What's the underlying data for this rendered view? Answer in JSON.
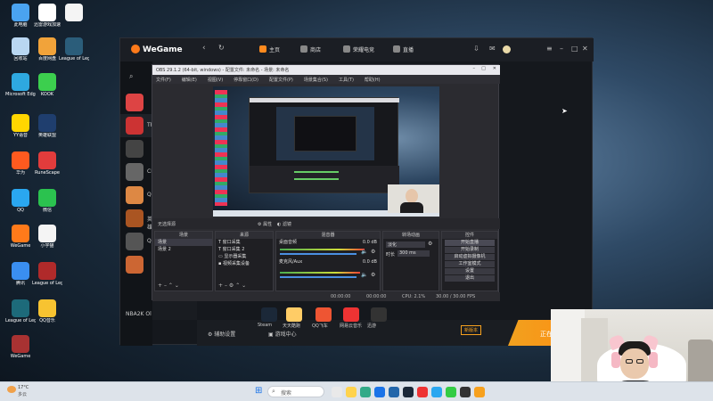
{
  "desktop": {
    "icons": [
      {
        "label": "此电脑",
        "color": "#4aa3f0"
      },
      {
        "label": "迅雷游戏加速",
        "color": "#ffffff"
      },
      {
        "label": "",
        "color": "#f4f4f4"
      },
      {
        "label": "回收站",
        "color": "#b9d7f2"
      },
      {
        "label": "百度网盘",
        "color": "#f1a33a"
      },
      {
        "label": "League of Legends",
        "color": "#2b5d7a"
      },
      {
        "label": "Microsoft Edge",
        "color": "#2ea8e0"
      },
      {
        "label": "KOOK",
        "color": "#3ccf4e"
      },
      {
        "label": "YY语音",
        "color": "#ffd600"
      },
      {
        "label": "英雄联盟",
        "color": "#1f3e6e"
      },
      {
        "label": "华为",
        "color": "#ff5a1f"
      },
      {
        "label": "RuneScape",
        "color": "#e23c3c"
      },
      {
        "label": "QQ",
        "color": "#2aa7f0"
      },
      {
        "label": "微信",
        "color": "#2bc24f"
      },
      {
        "label": "WeGame",
        "color": "#ff7a1a"
      },
      {
        "label": "小学猫",
        "color": "#f4f4f4"
      },
      {
        "label": "腾讯",
        "color": "#3a8ef0"
      },
      {
        "label": "League of Legends",
        "color": "#b02a2a"
      },
      {
        "label": "League of Legends",
        "color": "#1d6a7a"
      },
      {
        "label": "QQ音乐",
        "color": "#f7c331"
      },
      {
        "label": "WeGame",
        "color": "#a83232"
      }
    ],
    "mouse_icon": "cursor-arrow"
  },
  "wegame": {
    "logo": "WeGame",
    "nav": [
      "主页",
      "商店",
      "荣耀电竞",
      "直播"
    ],
    "games": [
      "",
      "TFT",
      "",
      "CF",
      "QQ",
      "英雄",
      "QQ",
      ""
    ],
    "nba_label": "NBA2K Ol",
    "bottom": {
      "left_btn": "辅助设置",
      "right_btn": "游戏中心",
      "mini_btn": "新版本",
      "launch": "正在运行"
    },
    "bottom_tiles": [
      "Steam",
      "天天酷跑",
      "QQ飞车",
      "网易云音乐",
      "迅游"
    ]
  },
  "obs": {
    "title": "OBS 29.1.2 (64-bit, windows) - 配置文件: 未命名 - 场景: 未命名",
    "menu": [
      "文件(F)",
      "编辑(E)",
      "视图(V)",
      "停靠窗口(D)",
      "配置文件(P)",
      "场景集合(S)",
      "工具(T)",
      "帮助(H)"
    ],
    "toolbar_label": "无选择源",
    "toolbar_btn1": "属性",
    "toolbar_btn2": "滤镜",
    "docks": {
      "scenes": {
        "title": "场景",
        "items": [
          "场景",
          "场景 2"
        ]
      },
      "sources": {
        "title": "来源",
        "items": [
          "窗口采集",
          "窗口采集 2",
          "显示器采集",
          "视频采集设备"
        ]
      },
      "mixer": {
        "title": "混音器",
        "items": [
          {
            "name": "桌面音频",
            "db": "0.0 dB"
          },
          {
            "name": "麦克风/Aux",
            "db": "0.0 dB"
          }
        ]
      },
      "transitions": {
        "title": "转场动画",
        "type": "淡化",
        "duration_label": "时长",
        "duration": "300 ms"
      },
      "controls": {
        "title": "控件",
        "buttons": [
          "开始直播",
          "开始录制",
          "启动虚拟摄像机",
          "工作室模式",
          "设置",
          "退出"
        ]
      }
    },
    "status": {
      "live": "00:00:00",
      "rec": "00:00:00",
      "cpu": "CPU: 2.1%",
      "fps": "30.00 / 30.00 FPS"
    }
  },
  "webcam": {
    "label": "webcam-feed"
  },
  "taskbar": {
    "weather_temp": "17°C",
    "weather_text": "多云",
    "search_placeholder": "搜索"
  }
}
